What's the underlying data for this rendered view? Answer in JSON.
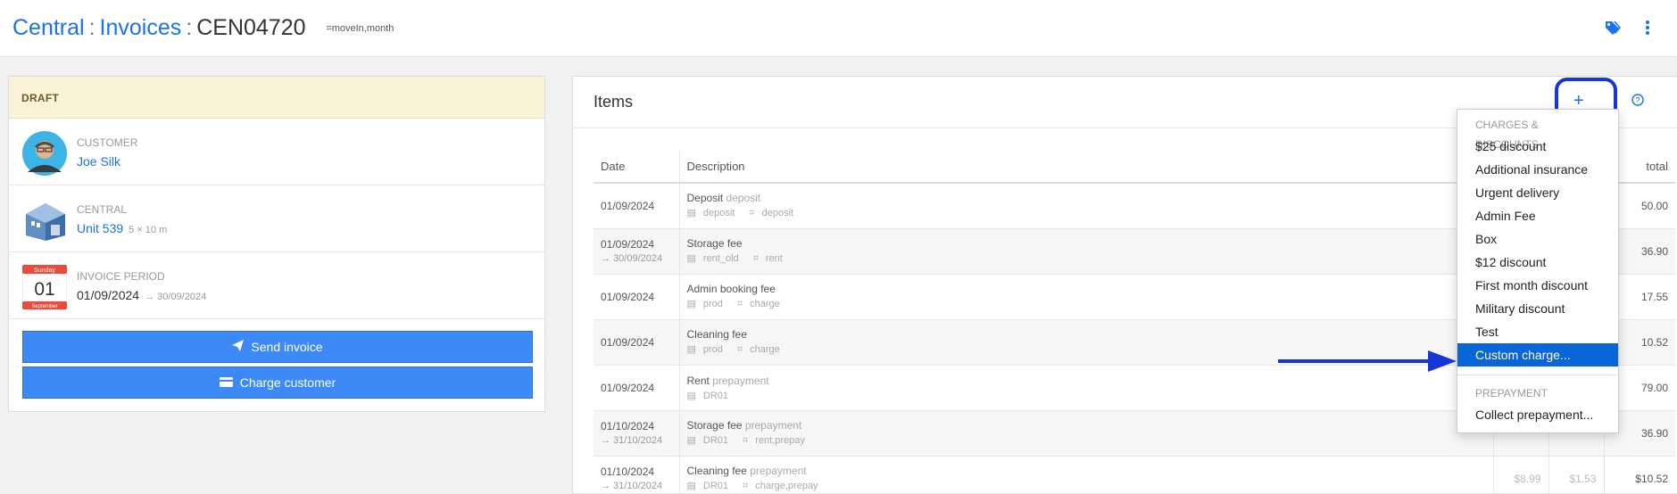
{
  "breadcrumb": {
    "root": "Central",
    "section": "Invoices",
    "current": "CEN04720",
    "tags": "moveIn,month"
  },
  "header_icons": [
    "tags-icon",
    "more-vert-icon"
  ],
  "status": {
    "label": "DRAFT"
  },
  "customer": {
    "label": "CUSTOMER",
    "name": "Joe Silk"
  },
  "site": {
    "label": "CENTRAL",
    "unit": "Unit 539",
    "size": "5 × 10 m"
  },
  "period": {
    "label": "INVOICE PERIOD",
    "day": "Sunday",
    "date_num": "01",
    "month": "September",
    "start": "01/09/2024",
    "end": "→ 30/09/2024"
  },
  "actions": {
    "send": "Send invoice",
    "charge": "Charge customer"
  },
  "items": {
    "title": "Items",
    "add_label": "+",
    "columns": {
      "date": "Date",
      "description": "Description",
      "total": "total"
    },
    "rows": [
      {
        "date": "01/09/2024",
        "date_end": "",
        "desc": "Deposit",
        "note": "deposit",
        "code": "deposit",
        "tags": "deposit",
        "a": "",
        "b": "",
        "total": "50.00"
      },
      {
        "date": "01/09/2024",
        "date_end": "→ 30/09/2024",
        "desc": "Storage fee",
        "note": "",
        "code": "rent_old",
        "tags": "rent",
        "a": "",
        "b": "",
        "total": "36.90"
      },
      {
        "date": "01/09/2024",
        "date_end": "",
        "desc": "Admin booking fee",
        "note": "",
        "code": "prod",
        "tags": "charge",
        "a": "",
        "b": "",
        "total": "17.55"
      },
      {
        "date": "01/09/2024",
        "date_end": "",
        "desc": "Cleaning fee",
        "note": "",
        "code": "prod",
        "tags": "charge",
        "a": "",
        "b": "",
        "total": "10.52"
      },
      {
        "date": "01/09/2024",
        "date_end": "",
        "desc": "Rent",
        "note": "prepayment",
        "code": "DR01",
        "tags": "",
        "a": "",
        "b": "",
        "total": "79.00"
      },
      {
        "date": "01/10/2024",
        "date_end": "→ 31/10/2024",
        "desc": "Storage fee",
        "note": "prepayment",
        "code": "DR01",
        "tags": "rent,prepay",
        "a": "",
        "b": "",
        "total": "36.90"
      },
      {
        "date": "01/10/2024",
        "date_end": "→ 31/10/2024",
        "desc": "Cleaning fee",
        "note": "prepayment",
        "code": "DR01",
        "tags": "charge,prepay",
        "a": "$8.99",
        "b": "$1.53",
        "total": "$10.52"
      }
    ]
  },
  "menu": {
    "section1": "CHARGES & DISCOUNTS",
    "items": [
      "$25 discount",
      "Additional insurance",
      "Urgent delivery",
      "Admin Fee",
      "Box",
      "$12 discount",
      "First month discount",
      "Military discount",
      "Test",
      "Custom charge..."
    ],
    "active": "Custom charge...",
    "section2": "PREPAYMENT",
    "items2": [
      "Collect prepayment..."
    ]
  },
  "colors": {
    "accent": "#1a73e8",
    "button": "#3d8af7",
    "highlight": "#1636d8",
    "menu_active": "#0a66d6",
    "draft_bg": "#fbf3d8"
  }
}
